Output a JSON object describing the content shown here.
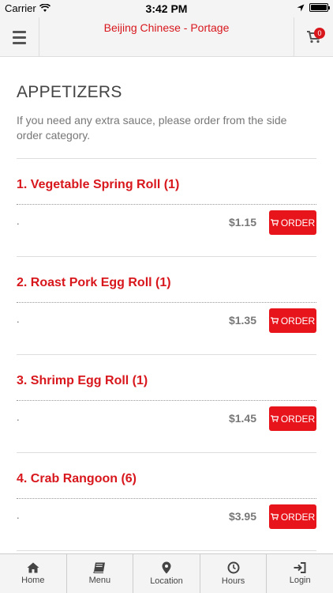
{
  "status_bar": {
    "carrier": "Carrier",
    "time": "3:42 PM"
  },
  "header": {
    "title": "Beijing Chinese - Portage",
    "cart_count": "0"
  },
  "section": {
    "title": "APPETIZERS",
    "description": "If you need any extra sauce, please order from the side order category."
  },
  "items": [
    {
      "name": "1. Vegetable Spring Roll (1)",
      "description": ".",
      "price": "$1.15",
      "order_label": "ORDER"
    },
    {
      "name": "2. Roast Pork Egg Roll (1)",
      "description": ".",
      "price": "$1.35",
      "order_label": "ORDER"
    },
    {
      "name": "3. Shrimp Egg Roll (1)",
      "description": ".",
      "price": "$1.45",
      "order_label": "ORDER"
    },
    {
      "name": "4. Crab Rangoon (6)",
      "description": ".",
      "price": "$3.95",
      "order_label": "ORDER"
    }
  ],
  "nav": [
    {
      "label": "Home",
      "icon": "home-icon"
    },
    {
      "label": "Menu",
      "icon": "book-icon"
    },
    {
      "label": "Location",
      "icon": "map-pin-icon"
    },
    {
      "label": "Hours",
      "icon": "clock-icon"
    },
    {
      "label": "Login",
      "icon": "login-icon"
    }
  ],
  "colors": {
    "accent": "#d8171d",
    "button": "#e8141b",
    "header_bg": "#f4f4f4"
  }
}
